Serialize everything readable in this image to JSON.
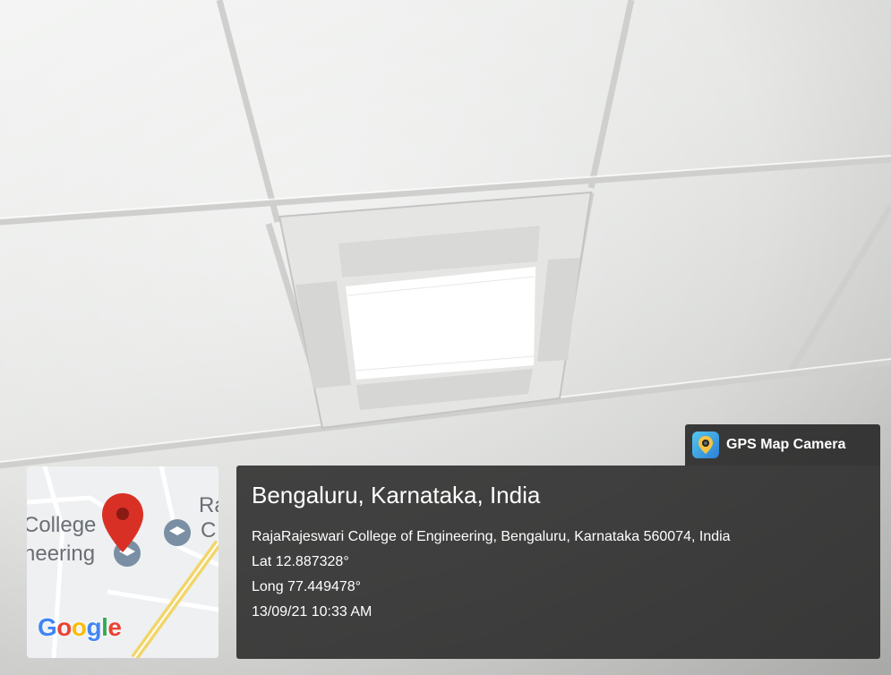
{
  "brand": {
    "label": "GPS Map Camera",
    "icon": "gps-camera-app-icon"
  },
  "location": {
    "place": "Bengaluru, Karnataka, India",
    "address": "RajaRajeswari College of Engineering, Bengaluru, Karnataka 560074, India",
    "latitude": "Lat 12.887328°",
    "longitude": "Long 77.449478°",
    "datetime": "13/09/21 10:33 AM"
  },
  "map": {
    "label_line1": "College",
    "label_line2": "neering",
    "label_right1": "Ra",
    "label_right2": "C",
    "logo": "Google",
    "pin_color": "#d93025"
  }
}
